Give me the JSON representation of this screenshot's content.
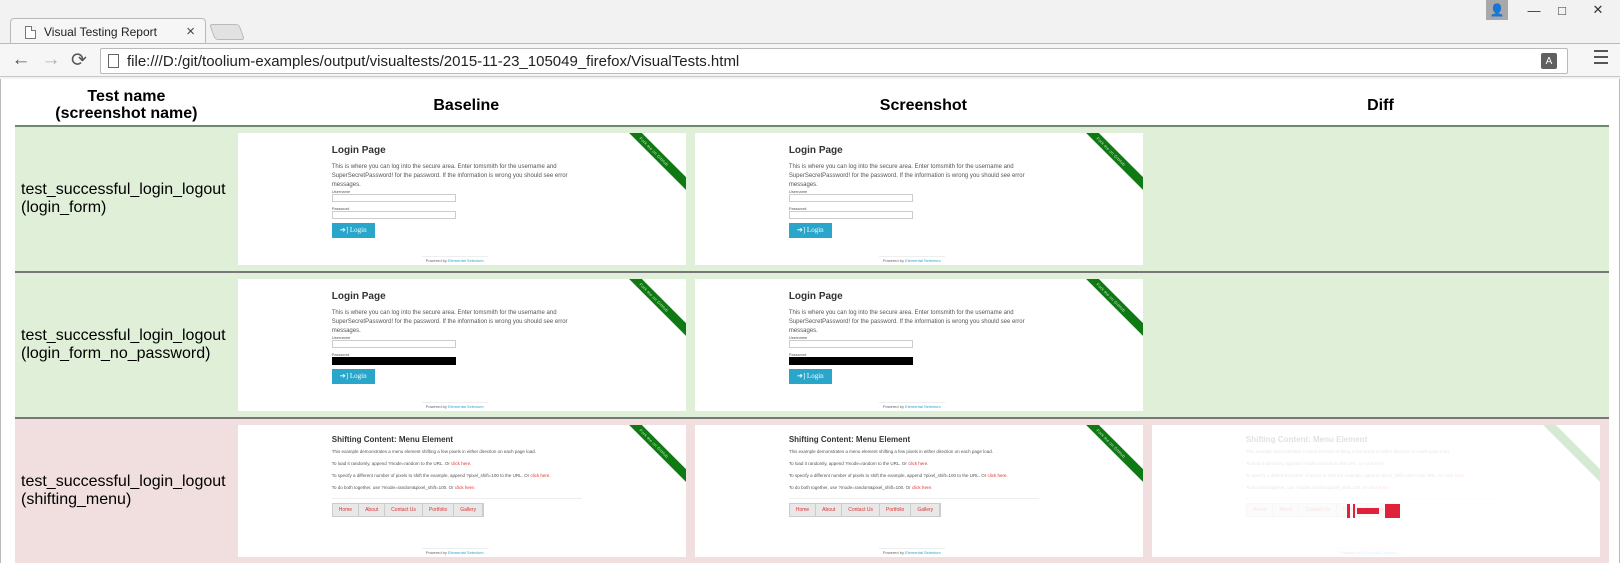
{
  "window": {
    "tab_title": "Visual Testing Report",
    "tab_close": "×",
    "controls": {
      "profile": "👤",
      "minimize": "—",
      "maximize": "□",
      "close": "✕"
    }
  },
  "toolbar": {
    "back": "←",
    "forward": "→",
    "reload": "⟳",
    "url": "file:///D:/git/toolium-examples/output/visualtests/2015-11-23_105049_firefox/VisualTests.html",
    "translate": "A"
  },
  "report": {
    "headers": {
      "name_line1": "Test name",
      "name_line2": "(screenshot name)",
      "baseline": "Baseline",
      "screenshot": "Screenshot",
      "diff": "Diff"
    },
    "rows": [
      {
        "test": "test_successful_login_logout",
        "screenshot_name": "(login_form)",
        "status": "ok"
      },
      {
        "test": "test_successful_login_logout",
        "screenshot_name": "(login_form_no_password)",
        "status": "ok"
      },
      {
        "test": "test_successful_login_logout",
        "screenshot_name": "(shifting_menu)",
        "status": "fail"
      }
    ],
    "status_colors": {
      "ok": "#e0f0d8",
      "fail": "#f1dede"
    }
  },
  "login_thumb": {
    "ribbon": "Fork me on GitHub",
    "title": "Login Page",
    "para": "This is where you can log into the secure area. Enter tomsmith for the username and SuperSecretPassword! for the password. If the information is wrong you should see error messages.",
    "username_label": "Username",
    "password_label": "Password",
    "button": "➔] Login",
    "footer_prefix": "Powered by",
    "footer_link": "Elemental Selenium"
  },
  "menu_thumb": {
    "ribbon": "Fork me on GitHub",
    "title": "Shifting Content: Menu Element",
    "line1": "This example demonstrates a menu element shifting a few pixels in either direction on each page load.",
    "line2_prefix": "To load it randomly, append ?mode=random to the URL. Or",
    "line3_prefix": "To specify a different number of pixels to shift the example, append ?pixel_shift=100 to the URL. Or",
    "line4_prefix": "To do both together, use ?mode=random&pixel_shift=100. Or",
    "link": "click here.",
    "menu": [
      "Home",
      "About",
      "Contact Us",
      "Portfolio",
      "Gallery"
    ],
    "footer_prefix": "Powered by",
    "footer_link": "Elemental Selenium"
  }
}
